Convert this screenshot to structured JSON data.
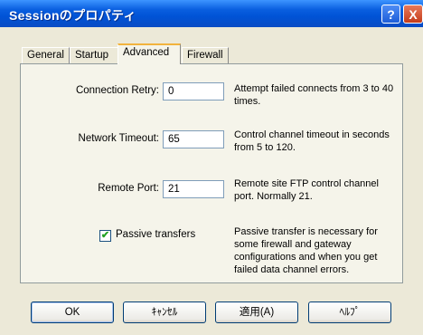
{
  "window": {
    "title": "Sessionのプロパティ",
    "help_glyph": "?",
    "close_glyph": "X"
  },
  "tabs": [
    {
      "label": "General"
    },
    {
      "label": "Startup"
    },
    {
      "label": "Advanced"
    },
    {
      "label": "Firewall"
    }
  ],
  "active_tab": "Advanced",
  "fields": {
    "connection_retry": {
      "label": "Connection Retry:",
      "value": "0",
      "description": "Attempt failed connects from 3 to 40 times."
    },
    "network_timeout": {
      "label": "Network Timeout:",
      "value": "65",
      "description": "Control channel timeout in seconds from 5 to 120."
    },
    "remote_port": {
      "label": "Remote Port:",
      "value": "21",
      "description": "Remote site FTP control channel port. Normally 21."
    }
  },
  "passive": {
    "label": "Passive transfers",
    "checked": true,
    "check_glyph": "✔",
    "description": "Passive transfer is necessary for some firewall and gateway configurations and when you get failed data channel errors."
  },
  "buttons": {
    "ok": "OK",
    "cancel": "ｷｬﾝｾﾙ",
    "apply": "適用(A)",
    "help": "ﾍﾙﾌﾟ"
  }
}
